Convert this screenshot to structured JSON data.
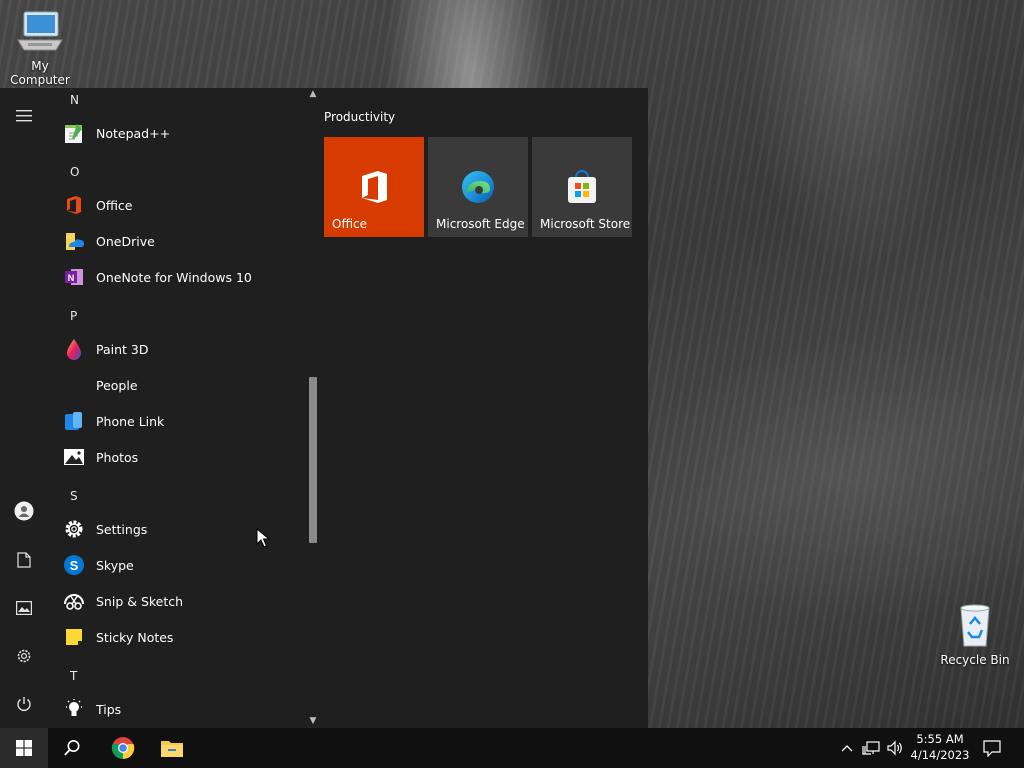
{
  "desktop": {
    "icons": [
      {
        "label": "My Computer"
      },
      {
        "label": "Recycle Bin"
      }
    ]
  },
  "start_menu": {
    "letters": {
      "n": "N",
      "o": "O",
      "p": "P",
      "s": "S",
      "t": "T"
    },
    "apps": [
      {
        "label": "Notepad++",
        "icon": "notepad-plus-plus-icon"
      },
      {
        "label": "Office",
        "icon": "office-icon"
      },
      {
        "label": "OneDrive",
        "icon": "onedrive-icon"
      },
      {
        "label": "OneNote for Windows 10",
        "icon": "onenote-icon"
      },
      {
        "label": "Paint 3D",
        "icon": "paint-3d-icon"
      },
      {
        "label": "People",
        "icon": "people-icon"
      },
      {
        "label": "Phone Link",
        "icon": "phone-link-icon"
      },
      {
        "label": "Photos",
        "icon": "photos-icon"
      },
      {
        "label": "Settings",
        "icon": "settings-gear-icon"
      },
      {
        "label": "Skype",
        "icon": "skype-icon"
      },
      {
        "label": "Snip & Sketch",
        "icon": "snip-sketch-icon"
      },
      {
        "label": "Sticky Notes",
        "icon": "sticky-notes-icon"
      },
      {
        "label": "Tips",
        "icon": "tips-lightbulb-icon"
      }
    ],
    "tiles": {
      "header": "Productivity",
      "items": [
        {
          "label": "Office",
          "color": "#d83b01"
        },
        {
          "label": "Microsoft Edge",
          "color": "#3a3a3a"
        },
        {
          "label": "Microsoft Store",
          "color": "#3a3a3a"
        }
      ]
    }
  },
  "taskbar": {
    "clock": {
      "time": "5:55 AM",
      "date": "4/14/2023"
    }
  },
  "colors": {
    "start_bg": "#1f1f1f",
    "taskbar_bg": "#101010",
    "office_tile": "#d83b01",
    "tile_bg": "#3a3a3a"
  }
}
